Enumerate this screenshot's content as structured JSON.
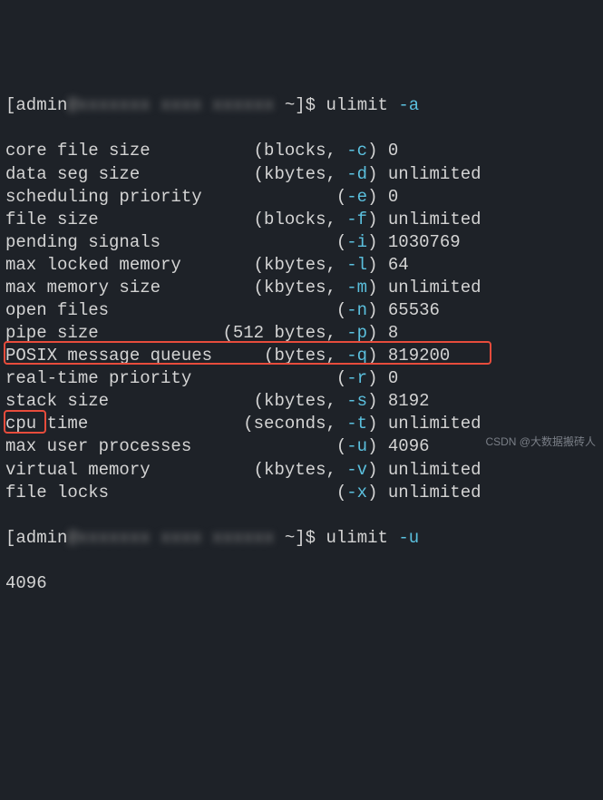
{
  "prompt1": {
    "user_prefix": "[admin",
    "blur": "@xxxxxxx xxxx xxxxxx",
    "path": " ~]$ ",
    "cmd": "ulimit ",
    "flag": "-a"
  },
  "prompt2": {
    "user_prefix": "[admin",
    "blur": "@xxxxxxx xxxx xxxxxx",
    "path": " ~]$ ",
    "cmd": "ulimit ",
    "flag": "-u"
  },
  "rows": [
    {
      "desc": "core file size          ",
      "unit": "(blocks, ",
      "flag": "-c",
      "close": ") ",
      "val": "0"
    },
    {
      "desc": "data seg size           ",
      "unit": "(kbytes, ",
      "flag": "-d",
      "close": ") ",
      "val": "unlimited"
    },
    {
      "desc": "scheduling priority             ",
      "unit": "(",
      "flag": "-e",
      "close": ") ",
      "val": "0"
    },
    {
      "desc": "file size               ",
      "unit": "(blocks, ",
      "flag": "-f",
      "close": ") ",
      "val": "unlimited"
    },
    {
      "desc": "pending signals                 ",
      "unit": "(",
      "flag": "-i",
      "close": ") ",
      "val": "1030769"
    },
    {
      "desc": "max locked memory       ",
      "unit": "(kbytes, ",
      "flag": "-l",
      "close": ") ",
      "val": "64"
    },
    {
      "desc": "max memory size         ",
      "unit": "(kbytes, ",
      "flag": "-m",
      "close": ") ",
      "val": "unlimited"
    },
    {
      "desc": "open files                      ",
      "unit": "(",
      "flag": "-n",
      "close": ") ",
      "val": "65536"
    },
    {
      "desc": "pipe size            ",
      "unit": "(512 bytes, ",
      "flag": "-p",
      "close": ") ",
      "val": "8"
    },
    {
      "desc": "POSIX message queues     ",
      "unit": "(bytes, ",
      "flag": "-q",
      "close": ") ",
      "val": "819200"
    },
    {
      "desc": "real-time priority              ",
      "unit": "(",
      "flag": "-r",
      "close": ") ",
      "val": "0"
    },
    {
      "desc": "stack size              ",
      "unit": "(kbytes, ",
      "flag": "-s",
      "close": ") ",
      "val": "8192"
    },
    {
      "desc": "cpu time               ",
      "unit": "(seconds, ",
      "flag": "-t",
      "close": ") ",
      "val": "unlimited"
    },
    {
      "desc": "max user processes              ",
      "unit": "(",
      "flag": "-u",
      "close": ") ",
      "val": "4096"
    },
    {
      "desc": "virtual memory          ",
      "unit": "(kbytes, ",
      "flag": "-v",
      "close": ") ",
      "val": "unlimited"
    },
    {
      "desc": "file locks                      ",
      "unit": "(",
      "flag": "-x",
      "close": ") ",
      "val": "unlimited"
    }
  ],
  "result2": "4096",
  "watermark": "CSDN @大数据搬砖人"
}
